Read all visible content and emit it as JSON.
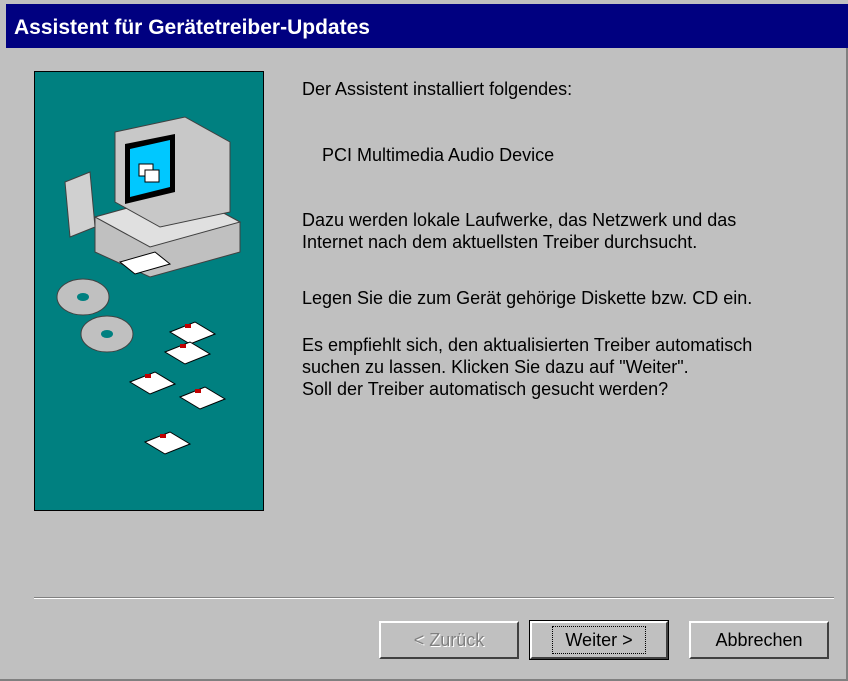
{
  "window": {
    "title": "Assistent für Gerätetreiber-Updates"
  },
  "content": {
    "intro": "Der Assistent installiert folgendes:",
    "device": "PCI Multimedia Audio Device",
    "para1_line1": "Dazu werden lokale Laufwerke, das Netzwerk und das",
    "para1_line2": "Internet nach dem aktuellsten Treiber durchsucht.",
    "para2": "Legen Sie die zum Gerät gehörige Diskette bzw. CD ein.",
    "para3_line1": "Es empfiehlt sich, den aktualisierten Treiber automatisch",
    "para3_line2": "suchen zu lassen. Klicken Sie dazu auf \"Weiter\".",
    "para3_line3": "Soll der Treiber automatisch gesucht werden?"
  },
  "buttons": {
    "back": "< Zurück",
    "next": "Weiter >",
    "cancel": "Abbrechen"
  },
  "colors": {
    "titlebar": "#000080",
    "dialog": "#c0c0c0",
    "illustration_bg": "#008080"
  }
}
